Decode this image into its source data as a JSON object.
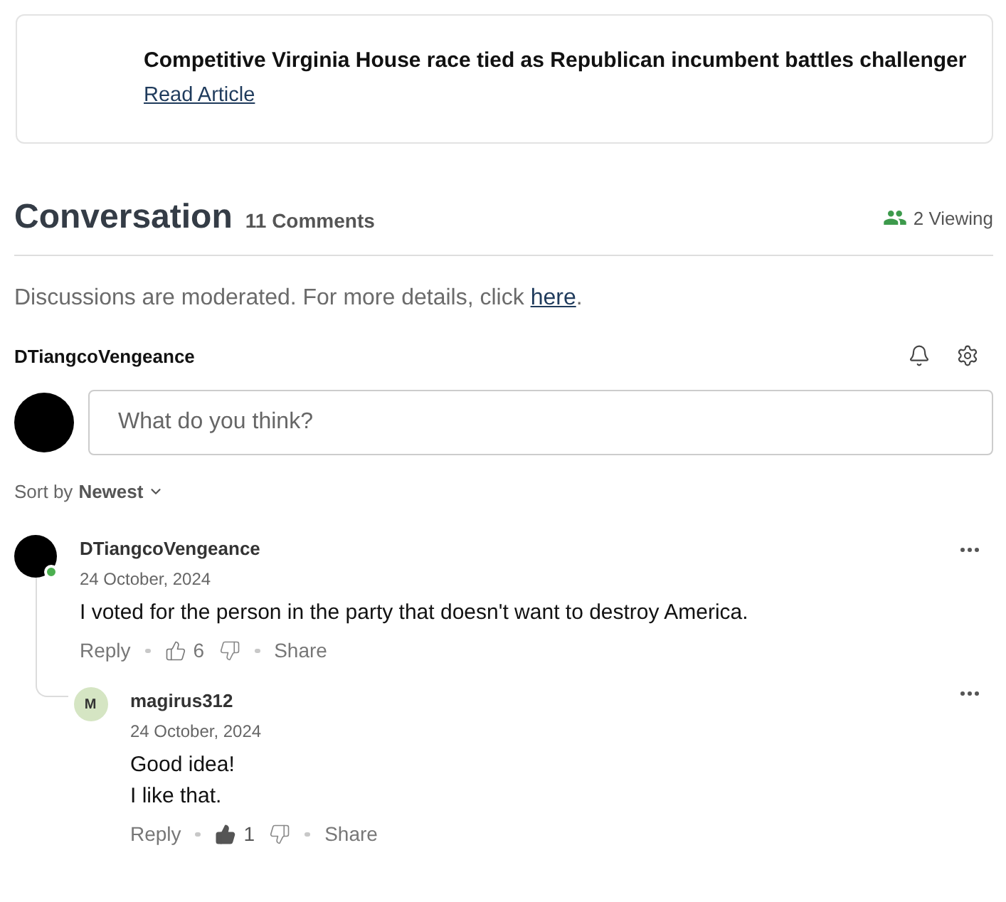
{
  "article_card": {
    "headline": "Competitive Virginia House race tied as Republican incumbent battles challenger",
    "link": "Read Article"
  },
  "conversation": {
    "title": "Conversation",
    "count": "11 Comments",
    "viewing": "2 Viewing"
  },
  "notice": {
    "text": "Discussions are moderated. For more details, click",
    "link": "here",
    "after": "."
  },
  "current_user": {
    "name": "DTiangcoVengeance"
  },
  "composer": {
    "placeholder": "What do you think?"
  },
  "sort": {
    "label": "Sort by",
    "value": "Newest"
  },
  "comments": [
    {
      "author": "DTiangcoVengeance",
      "avatar": {
        "kind": "photo"
      },
      "online": true,
      "date": "24 October, 2024",
      "body": [
        "I voted for the person in the party that doesn't want to destroy America."
      ],
      "reply_label": "Reply",
      "likes": "6",
      "liked": false,
      "share_label": "Share",
      "children": [
        {
          "author": "magirus312",
          "avatar": {
            "kind": "initial",
            "initial": "M"
          },
          "online": false,
          "date": "24 October, 2024",
          "body": [
            "Good idea!",
            "I like that."
          ],
          "reply_label": "Reply",
          "likes": "1",
          "liked": true,
          "share_label": "Share"
        }
      ]
    }
  ]
}
